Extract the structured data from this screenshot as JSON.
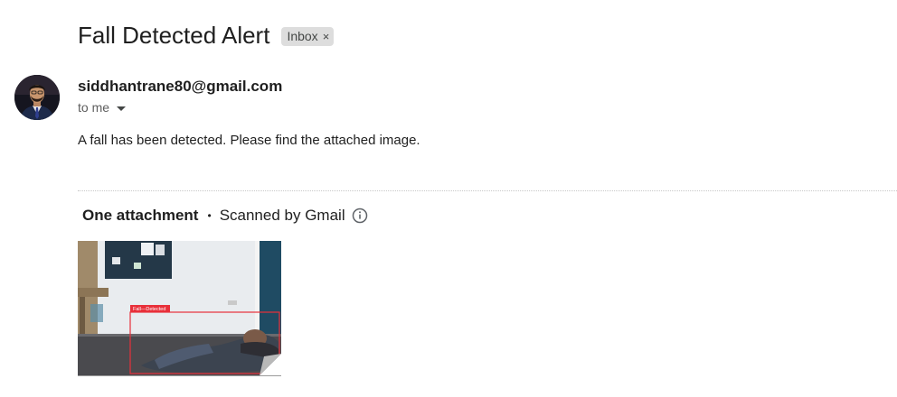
{
  "email": {
    "subject": "Fall Detected Alert",
    "label": "Inbox",
    "label_remove_glyph": "×",
    "sender_email": "siddhantrane80@gmail.com",
    "recipient": "to me",
    "body": "A fall has been detected. Please find the attached image."
  },
  "attachments": {
    "count_label": "One attachment",
    "separator": "•",
    "scan_label": "Scanned by Gmail",
    "files": [
      {
        "detection_label": "Fall—Detected"
      }
    ]
  },
  "icons": {
    "avatar": "avatar-photo",
    "caret": "caret-down-icon",
    "info": "info-icon",
    "page_curl": "page-curl-icon"
  },
  "colors": {
    "detection_box": "#e8303a",
    "chip_bg": "#dddddd"
  }
}
